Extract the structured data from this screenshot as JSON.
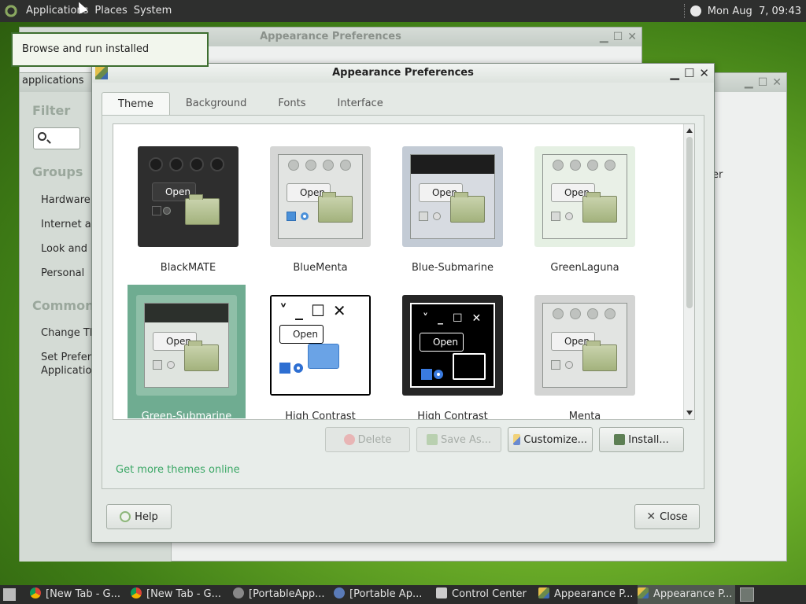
{
  "top_panel": {
    "menus": [
      "Applications",
      "Places",
      "System"
    ],
    "clock": "Mon Aug  7, 09:43"
  },
  "tooltip": "Browse and run installed applications",
  "bg_appearance_window": {
    "title": "Appearance Preferences"
  },
  "control_center": {
    "filter_heading": "Filter",
    "groups_heading": "Groups",
    "groups": [
      "Hardware",
      "Internet an",
      "Look and F",
      "Personal"
    ],
    "common_heading": "Common T",
    "common_items": [
      "Change Th",
      "Set Preferr",
      "Application"
    ],
    "right_fragment": "er"
  },
  "dialog": {
    "title": "Appearance Preferences",
    "tabs": [
      {
        "label": "Theme",
        "active": true
      },
      {
        "label": "Background",
        "active": false
      },
      {
        "label": "Fonts",
        "active": false
      },
      {
        "label": "Interface",
        "active": false
      }
    ],
    "themes": [
      {
        "name": "BlackMATE",
        "selected": false
      },
      {
        "name": "BlueMenta",
        "selected": false
      },
      {
        "name": "Blue-Submarine",
        "selected": false
      },
      {
        "name": "GreenLaguna",
        "selected": false
      },
      {
        "name": "Green-Submarine",
        "selected": true
      },
      {
        "name": "High Contrast",
        "selected": false
      },
      {
        "name": "High Contrast",
        "selected": false
      },
      {
        "name": "Menta",
        "selected": false
      }
    ],
    "preview_open_label": "Open",
    "actions": {
      "delete": "Delete",
      "save_as": "Save As...",
      "customize": "Customize...",
      "install": "Install..."
    },
    "get_more_link": "Get more themes online",
    "help": "Help",
    "close": "Close",
    "close_glyph": "✕"
  },
  "window_controls": {
    "minimize": "▁",
    "maximize": "☐",
    "close": "✕"
  },
  "taskbar": {
    "tasks": [
      {
        "label": "[New Tab - G...",
        "icon": "chrome-icon",
        "active": false
      },
      {
        "label": "[New Tab - G...",
        "icon": "chrome-icon",
        "active": false
      },
      {
        "label": "[PortableApp...",
        "icon": "portableapps-icon",
        "active": false
      },
      {
        "label": "[Portable Ap...",
        "icon": "globe-icon",
        "active": false
      },
      {
        "label": "Control Center",
        "icon": "control-center-icon",
        "active": false
      },
      {
        "label": "Appearance P...",
        "icon": "appearance-icon",
        "active": false
      },
      {
        "label": "Appearance P...",
        "icon": "appearance-icon",
        "active": true
      }
    ]
  }
}
